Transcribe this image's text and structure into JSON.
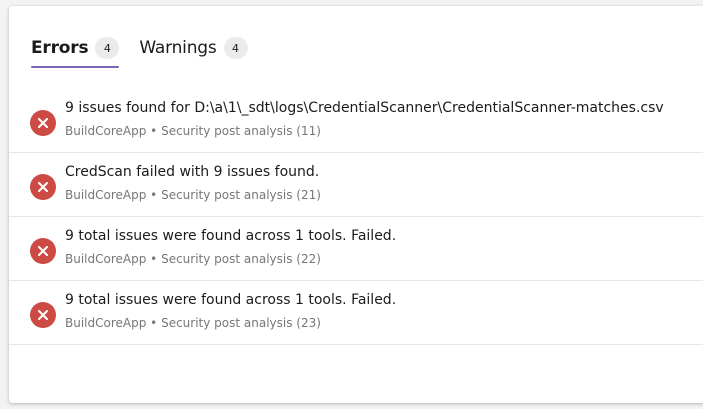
{
  "tabs": [
    {
      "label": "Errors",
      "count": "4",
      "selected": true
    },
    {
      "label": "Warnings",
      "count": "4",
      "selected": false
    }
  ],
  "colors": {
    "error": "#cd4a45",
    "tab_underline": "#7b63b5"
  },
  "errors": [
    {
      "title": "9 issues found for D:\\a\\1\\_sdt\\logs\\CredentialScanner\\CredentialScanner-matches.csv",
      "source": "BuildCoreApp",
      "separator": "•",
      "detail": "Security post analysis (11)",
      "icon": "error-circle-icon"
    },
    {
      "title": "CredScan failed with 9 issues found.",
      "source": "BuildCoreApp",
      "separator": "•",
      "detail": "Security post analysis (21)",
      "icon": "error-circle-icon"
    },
    {
      "title": "9 total issues were found across 1 tools. Failed.",
      "source": "BuildCoreApp",
      "separator": "•",
      "detail": "Security post analysis (22)",
      "icon": "error-circle-icon"
    },
    {
      "title": "9 total issues were found across 1 tools. Failed.",
      "source": "BuildCoreApp",
      "separator": "•",
      "detail": "Security post analysis (23)",
      "icon": "error-circle-icon"
    }
  ]
}
